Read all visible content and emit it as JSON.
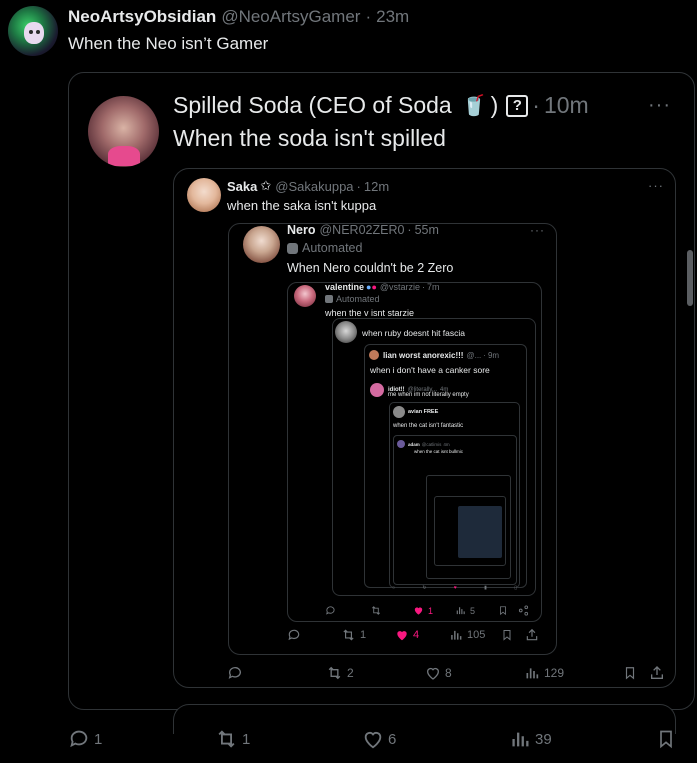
{
  "post": {
    "author_name": "NeoArtsyObsidian",
    "author_handle": "@NeoArtsyGamer",
    "time": "23m",
    "text": "When the Neo isn’t Gamer",
    "actions": {
      "replies": "1",
      "reposts": "1",
      "likes": "6",
      "views": "39"
    }
  },
  "quote1": {
    "author_name": "Spilled Soda (CEO of Soda",
    "emoji": "🥤",
    "badge": "?",
    "time": "10m",
    "text": "When the soda isn't spilled",
    "actions": {
      "reposts": "2",
      "likes": "8",
      "views": "129"
    }
  },
  "quote2": {
    "author_name": "Saka",
    "star": "✩",
    "author_handle": "@Sakakuppa",
    "time": "12m",
    "text": "when the saka isn't kuppa",
    "actions": {
      "reposts": "1",
      "likes": "4",
      "views": "105"
    }
  },
  "quote3": {
    "author_name": "Nero",
    "author_handle": "@NER02ZER0",
    "time": "55m",
    "automated": "Automated",
    "text": "When Nero couldn't be 2 Zero",
    "actions": {
      "likes": "1",
      "views": "5"
    }
  },
  "quote4": {
    "author_name": "valentine",
    "author_handle": "@vstarzie",
    "time": "7m",
    "automated": "Automated",
    "text": "when the v isnt starzie"
  },
  "quote5": {
    "text": "when ruby doesnt hit fascia"
  },
  "quote6": {
    "author_name": "lian worst anorexic!!!",
    "author_handle": "@...",
    "time": "9m",
    "text": "when i don't have a canker sore"
  },
  "quote7": {
    "author_name": "idiot!!",
    "author_handle": "@literally...",
    "time": "4m",
    "text": "me when im not literally empty"
  },
  "quote8": {
    "author_name": "avian FREE",
    "text": "when the cat isn't fantastic"
  },
  "quote9": {
    "author_name": "adam",
    "author_handle": "@catlimis",
    "time": "4m",
    "text": "when the cat isnt bullmic"
  },
  "colors": {
    "background": "#000000",
    "border": "#2f3336",
    "text": "#e7e9ea",
    "muted": "#71767b",
    "like": "#f91880"
  }
}
